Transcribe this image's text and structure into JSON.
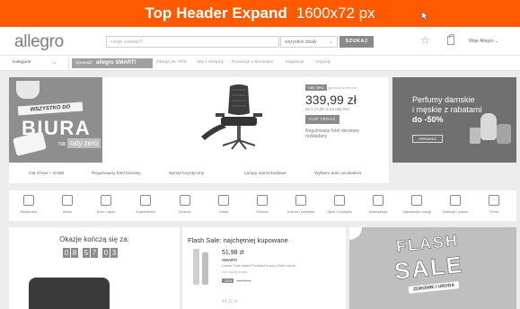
{
  "banner": {
    "title": "Top Header Expand",
    "size": "1600x72 px"
  },
  "header": {
    "logo": "allegro",
    "search_placeholder": "czego szukasz?",
    "department": "wszystkie działy",
    "search_button": "SZUKAJ",
    "account": "Moje Allegro"
  },
  "nav": {
    "categories": "Kategorie",
    "smart_prefix": "Sprawdź",
    "smart_logo": "allegro SMART!",
    "links": [
      "Okazje do -70%",
      "raty z reklamy",
      "Promocje z Monetami",
      "Inspiracje",
      "Artykuły"
    ]
  },
  "hero": {
    "left_banner_text": "WSZYSTKO DO",
    "left_big": "BIURA",
    "left_na": "na",
    "left_raty": "raty zero",
    "promo_badge": "raty zero",
    "promo_small": "sprawdź w ofercie",
    "price": "339,99 zł",
    "installments": "20 x 17,00 zł na raty 0%*",
    "buy_button": "KUP TERAZ",
    "product_desc": "Regulowany fotel obrotowy rozkładany",
    "tabs": [
      "Cat Chow + Gratis",
      "Regulowany fotel biurowy",
      "Sprzęt turystyczny",
      "Lampy samochodowe",
      "Wybierz auto od dealera"
    ]
  },
  "perfume": {
    "line1": "Perfumy damskie",
    "line2": "i męskie z rabatami",
    "line3": "do -50%",
    "button": "SPRAWDŹ"
  },
  "categories": [
    "Elektronika",
    "Moda",
    "Dom i ogród",
    "Supermarket",
    "Dziecko",
    "Uroda",
    "Zdrowie",
    "Kultura i rozrywka",
    "Sport i turystyka",
    "Motoryzacja",
    "Ogłoszenia i usługi",
    "Kolekcje i sztuka",
    "Firma"
  ],
  "offers": {
    "title": "Okazje kończą się za:",
    "timer": [
      "0",
      "8",
      "5",
      "7",
      "0",
      "3"
    ]
  },
  "flash": {
    "title": "Flash Sale: najchętniej kupowane",
    "price": "51,98 zł",
    "smart": "SMART!",
    "name": "Loreal True Match Podkład Kolory Dwie sztuki",
    "bought": "242 osoby kupiły",
    "tag": "-30%",
    "old_price": "109,00 zł",
    "more": "44,10 zł"
  },
  "flashsale": {
    "word1": "FLASH",
    "word2": "SALE",
    "sub": "ZDROWIE I URODA"
  },
  "colors": {
    "banner": "#ff5a00"
  }
}
